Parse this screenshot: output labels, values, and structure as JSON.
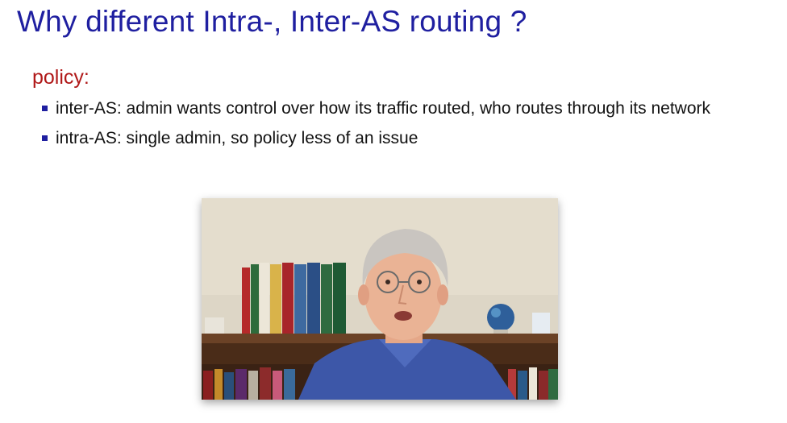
{
  "slide": {
    "title": "Why different Intra-, Inter-AS routing ?",
    "section_heading": "policy:",
    "bullets": [
      {
        "text": "inter-AS: admin wants control over how its traffic routed, who routes through its network"
      },
      {
        "text": "intra-AS: single admin, so policy less of an issue"
      }
    ]
  },
  "colors": {
    "title": "#1f1fa0",
    "heading": "#b01818",
    "bullet_marker": "#1f1fa0"
  }
}
